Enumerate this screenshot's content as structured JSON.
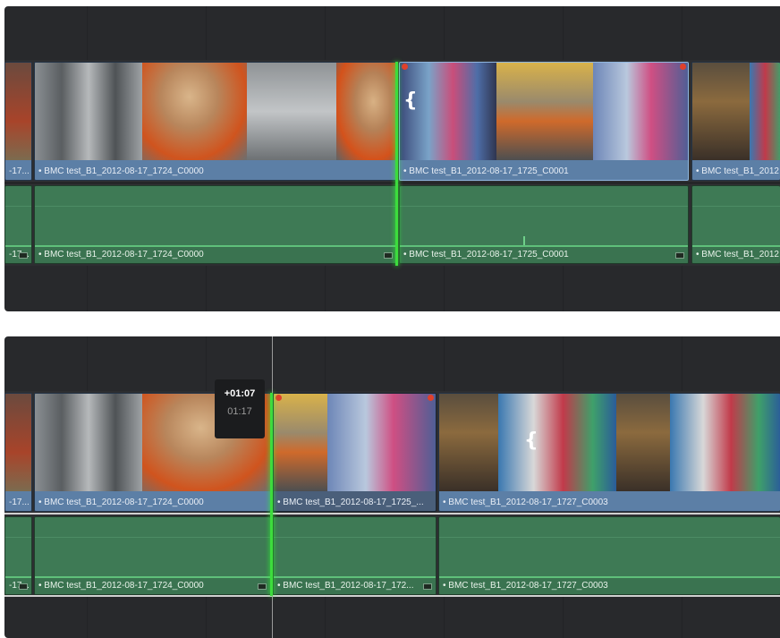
{
  "top_timeline": {
    "video_clips": [
      {
        "name": "-17...",
        "kind": "partial-left"
      },
      {
        "name": "• BMC test_B1_2012-08-17_1724_C0000"
      },
      {
        "name": "• BMC test_B1_2012-08-17_1725_C0001"
      },
      {
        "name": "• BMC test_B1_2012"
      }
    ],
    "audio_clips": [
      {
        "name": "-17..."
      },
      {
        "name": "• BMC test_B1_2012-08-17_1724_C0000"
      },
      {
        "name": "• BMC test_B1_2012-08-17_1725_C0001"
      },
      {
        "name": "• BMC test_B1_2012"
      }
    ]
  },
  "bottom_timeline": {
    "video_clips": [
      {
        "name": "-17..."
      },
      {
        "name": "• BMC test_B1_2012-08-17_1724_C0000"
      },
      {
        "name": "• BMC test_B1_2012-08-17_1725_..."
      },
      {
        "name": "• BMC test_B1_2012-08-17_1727_C0003"
      }
    ],
    "audio_clips": [
      {
        "name": "-17..."
      },
      {
        "name": "• BMC test_B1_2012-08-17_1724_C0000"
      },
      {
        "name": "• BMC test_B1_2012-08-17_172..."
      },
      {
        "name": "• BMC test_B1_2012-08-17_1727_C0003"
      }
    ],
    "tooltip": {
      "offset": "+01:07",
      "duration": "01:17"
    }
  },
  "colors": {
    "panel_bg": "#28292c",
    "video_clip": "#5c7fa6",
    "audio_clip": "#3e7a55",
    "playhead_green": "#3ddc3d",
    "marker_red": "#e0402b"
  }
}
